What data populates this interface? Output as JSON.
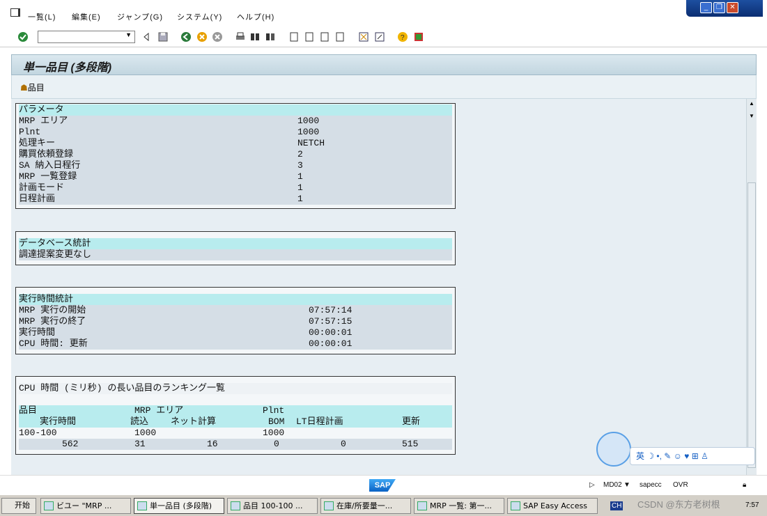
{
  "menubar": {
    "items": [
      "一覧(L)",
      "編集(E)",
      "ジャンプ(G)",
      "システム(Y)",
      "ヘルプ(H)"
    ]
  },
  "window": {
    "controls": [
      "_",
      "❐",
      "✕"
    ]
  },
  "toolbar": {
    "command_value": ""
  },
  "screen": {
    "title": "単一品目 (多段階)",
    "app_button": "品目"
  },
  "params": {
    "title": "パラメータ",
    "rows": [
      {
        "label": "MRP エリア",
        "value": "1000"
      },
      {
        "label": "Plnt",
        "value": "1000"
      },
      {
        "label": "処理キー",
        "value": "NETCH"
      },
      {
        "label": "購買依頼登録",
        "value": "2"
      },
      {
        "label": "SA 納入日程行",
        "value": "3"
      },
      {
        "label": "MRP 一覧登録",
        "value": "1"
      },
      {
        "label": "計画モード",
        "value": "1"
      },
      {
        "label": "日程計画",
        "value": "1"
      }
    ]
  },
  "dbstats": {
    "title": "データベース統計",
    "text": "調達提案変更なし"
  },
  "runtime": {
    "title": "実行時間統計",
    "rows": [
      {
        "label": "MRP 実行の開始",
        "value": "07:57:14"
      },
      {
        "label": "MRP 実行の終了",
        "value": "07:57:15"
      },
      {
        "label": "実行時間",
        "value": "00:00:01"
      },
      {
        "label": "CPU 時間: 更新",
        "value": "00:00:01"
      }
    ]
  },
  "ranking": {
    "title": "CPU 時間 (ミリ秒) の長い品目のランキング一覧",
    "h1": [
      "品目",
      "MRP エリア",
      "Plnt"
    ],
    "h2": [
      "実行時間",
      "読込",
      "ネット計算",
      "BOM",
      "LT日程計画",
      "更新"
    ],
    "r1": [
      "100-100",
      "1000",
      "1000"
    ],
    "r2": [
      "562",
      "31",
      "16",
      "0",
      "0",
      "515"
    ]
  },
  "status": {
    "tcode": "MD02",
    "server": "sapecc",
    "mode": "OVR",
    "logo": "SAP"
  },
  "taskbar": {
    "start": "开始",
    "tasks": [
      "ビユー \"MRP ...",
      "単一品目 (多段階)",
      "品目 100-100 ...",
      "在庫/所要量一...",
      "MRP 一覧: 第一...",
      "SAP Easy Access"
    ],
    "lang": "CH",
    "time": "7:57"
  },
  "widget": {
    "text": "英 ☽ •, ✎ ☺ ♥ ⊞ ♙"
  },
  "watermark": "CSDN @东方老树根"
}
